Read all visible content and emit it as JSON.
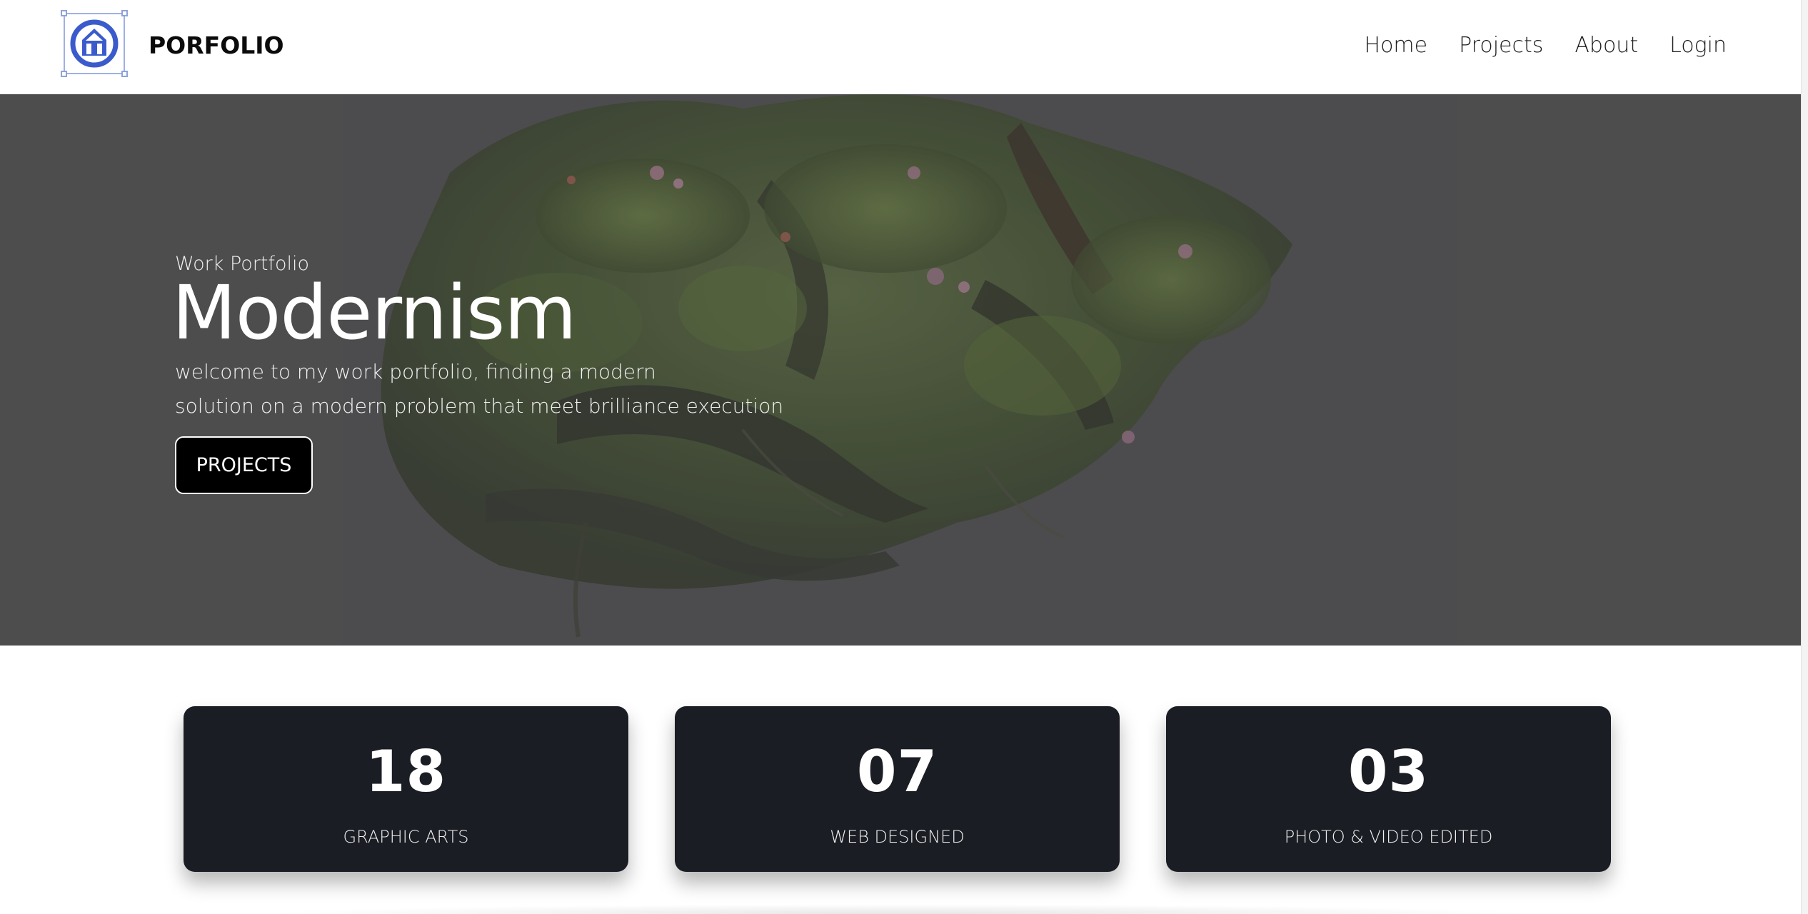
{
  "header": {
    "brand": "PORFOLIO",
    "logo_icon": "pencil-in-circle-icon",
    "nav": [
      {
        "label": "Home"
      },
      {
        "label": "Projects"
      },
      {
        "label": "About"
      },
      {
        "label": "Login"
      }
    ]
  },
  "hero": {
    "eyebrow": "Work Portfolio",
    "title": "Modernism",
    "description_line1": "welcome to my work portfolio, finding a modern",
    "description_line2": "solution on a modern problem that meet brilliance execution",
    "button_label": "PROJECTS",
    "background_color": "#4d4d4e",
    "art": "moss-covered floating rock sculpture"
  },
  "stats": [
    {
      "number": "18",
      "label": "GRAPHIC ARTS"
    },
    {
      "number": "07",
      "label": "WEB DESIGNED"
    },
    {
      "number": "03",
      "label": "PHOTO & VIDEO EDITED"
    }
  ],
  "colors": {
    "accent_logo": "#3b5bcc",
    "card_bg": "#1b1d24",
    "button_bg": "#000000"
  }
}
